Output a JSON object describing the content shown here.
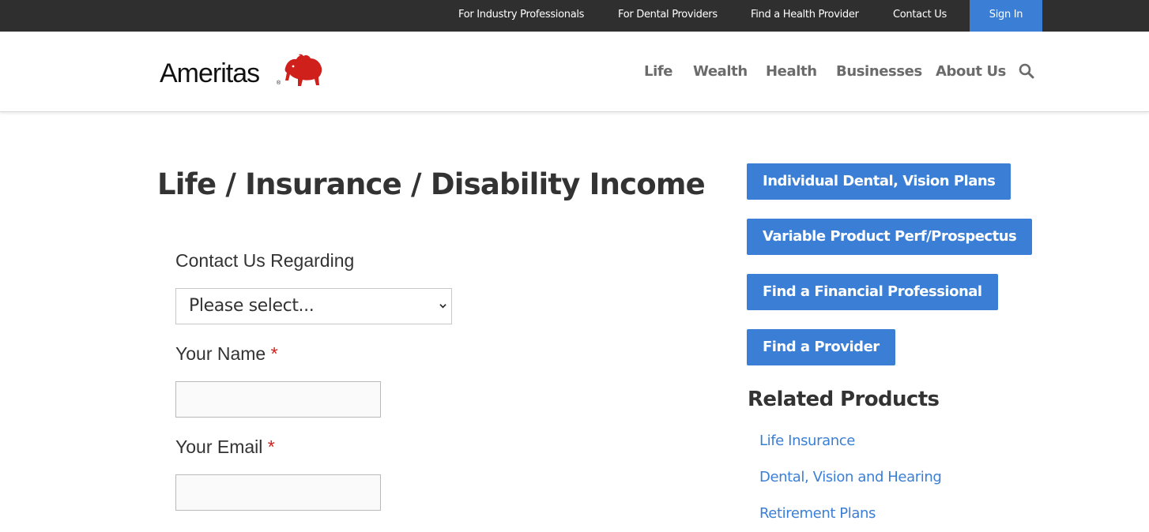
{
  "topbar": {
    "links": [
      "For Industry Professionals",
      "For Dental Providers",
      "Find a Health Provider",
      "Contact Us"
    ],
    "signin_label": "Sign In"
  },
  "header": {
    "logo_text": "Ameritas",
    "logo_reg": "®",
    "nav": [
      "Life",
      "Wealth",
      "Health",
      "Businesses",
      "About Us"
    ],
    "search_icon": "search-icon"
  },
  "main": {
    "title": "Life / Insurance / Disability Income",
    "form": {
      "regarding_label": "Contact Us Regarding",
      "regarding_value": "Please select...",
      "name_label": "Your Name",
      "name_value": "",
      "email_label": "Your Email",
      "email_value": "",
      "required_mark": "*"
    }
  },
  "sidebar": {
    "buttons": [
      "Individual Dental, Vision Plans",
      "Variable Product Perf/Prospectus",
      "Find a Financial Professional",
      "Find a Provider"
    ],
    "related_title": "Related Products",
    "related_links": [
      "Life Insurance",
      "Dental, Vision and Hearing",
      "Retirement Plans"
    ]
  },
  "colors": {
    "accent": "#3a7fd5",
    "topbar": "#2f2f2f",
    "required": "#d0201c",
    "brand_red": "#d0201c"
  }
}
